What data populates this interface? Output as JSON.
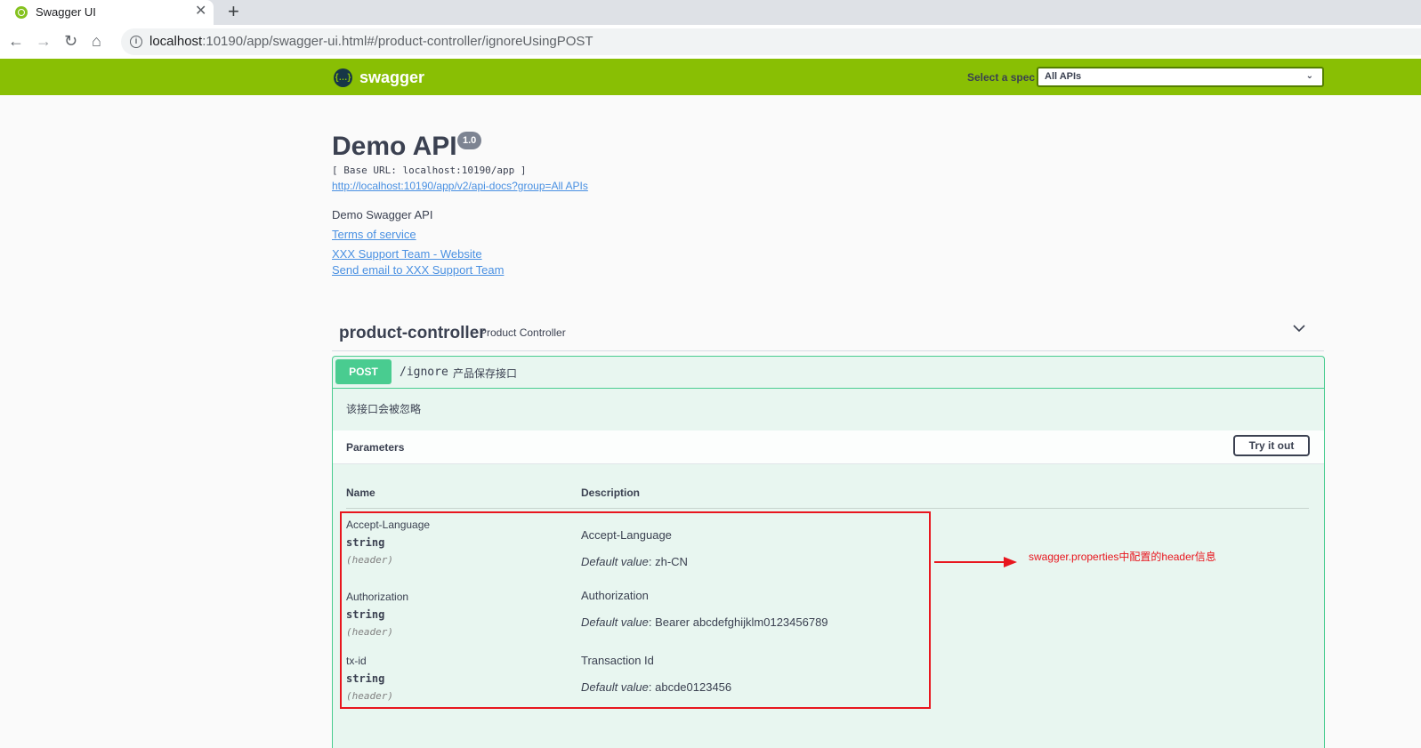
{
  "browser": {
    "tab_title": "Swagger UI",
    "url_host": "localhost",
    "url_path": ":10190/app/swagger-ui.html#/product-controller/ignoreUsingPOST"
  },
  "topbar": {
    "logo_text": "swagger",
    "spec_label": "Select a spec",
    "spec_value": "All APIs"
  },
  "info": {
    "title": "Demo API",
    "version": "1.0",
    "base_url": "[ Base URL: localhost:10190/app ]",
    "docs_link": "http://localhost:10190/app/v2/api-docs?group=All APIs",
    "description": "Demo Swagger API",
    "terms": "Terms of service",
    "website": "XXX Support Team - Website",
    "email": "Send email to XXX Support Team"
  },
  "tag": {
    "name": "product-controller",
    "description": "Product Controller"
  },
  "operation": {
    "method": "POST",
    "path": "/ignore",
    "summary": "产品保存接口",
    "description": "该接口会被忽略",
    "params_title": "Parameters",
    "try_label": "Try it out",
    "col_name": "Name",
    "col_description": "Description",
    "default_label": "Default value",
    "params": [
      {
        "name": "Accept-Language",
        "type": "string",
        "in": "(header)",
        "description": "Accept-Language",
        "default": ": zh-CN"
      },
      {
        "name": "Authorization",
        "type": "string",
        "in": "(header)",
        "description": "Authorization",
        "default": ": Bearer abcdefghijklm0123456789"
      },
      {
        "name": "tx-id",
        "type": "string",
        "in": "(header)",
        "description": "Transaction Id",
        "default": ": abcde0123456"
      }
    ]
  },
  "annotation": {
    "text": "swagger.properties中配置的header信息",
    "color": "#e8161e"
  },
  "colors": {
    "topbar": "#89bf04",
    "post": "#49cc90",
    "post_bg": "#e8f6f0",
    "link": "#4990e2"
  }
}
